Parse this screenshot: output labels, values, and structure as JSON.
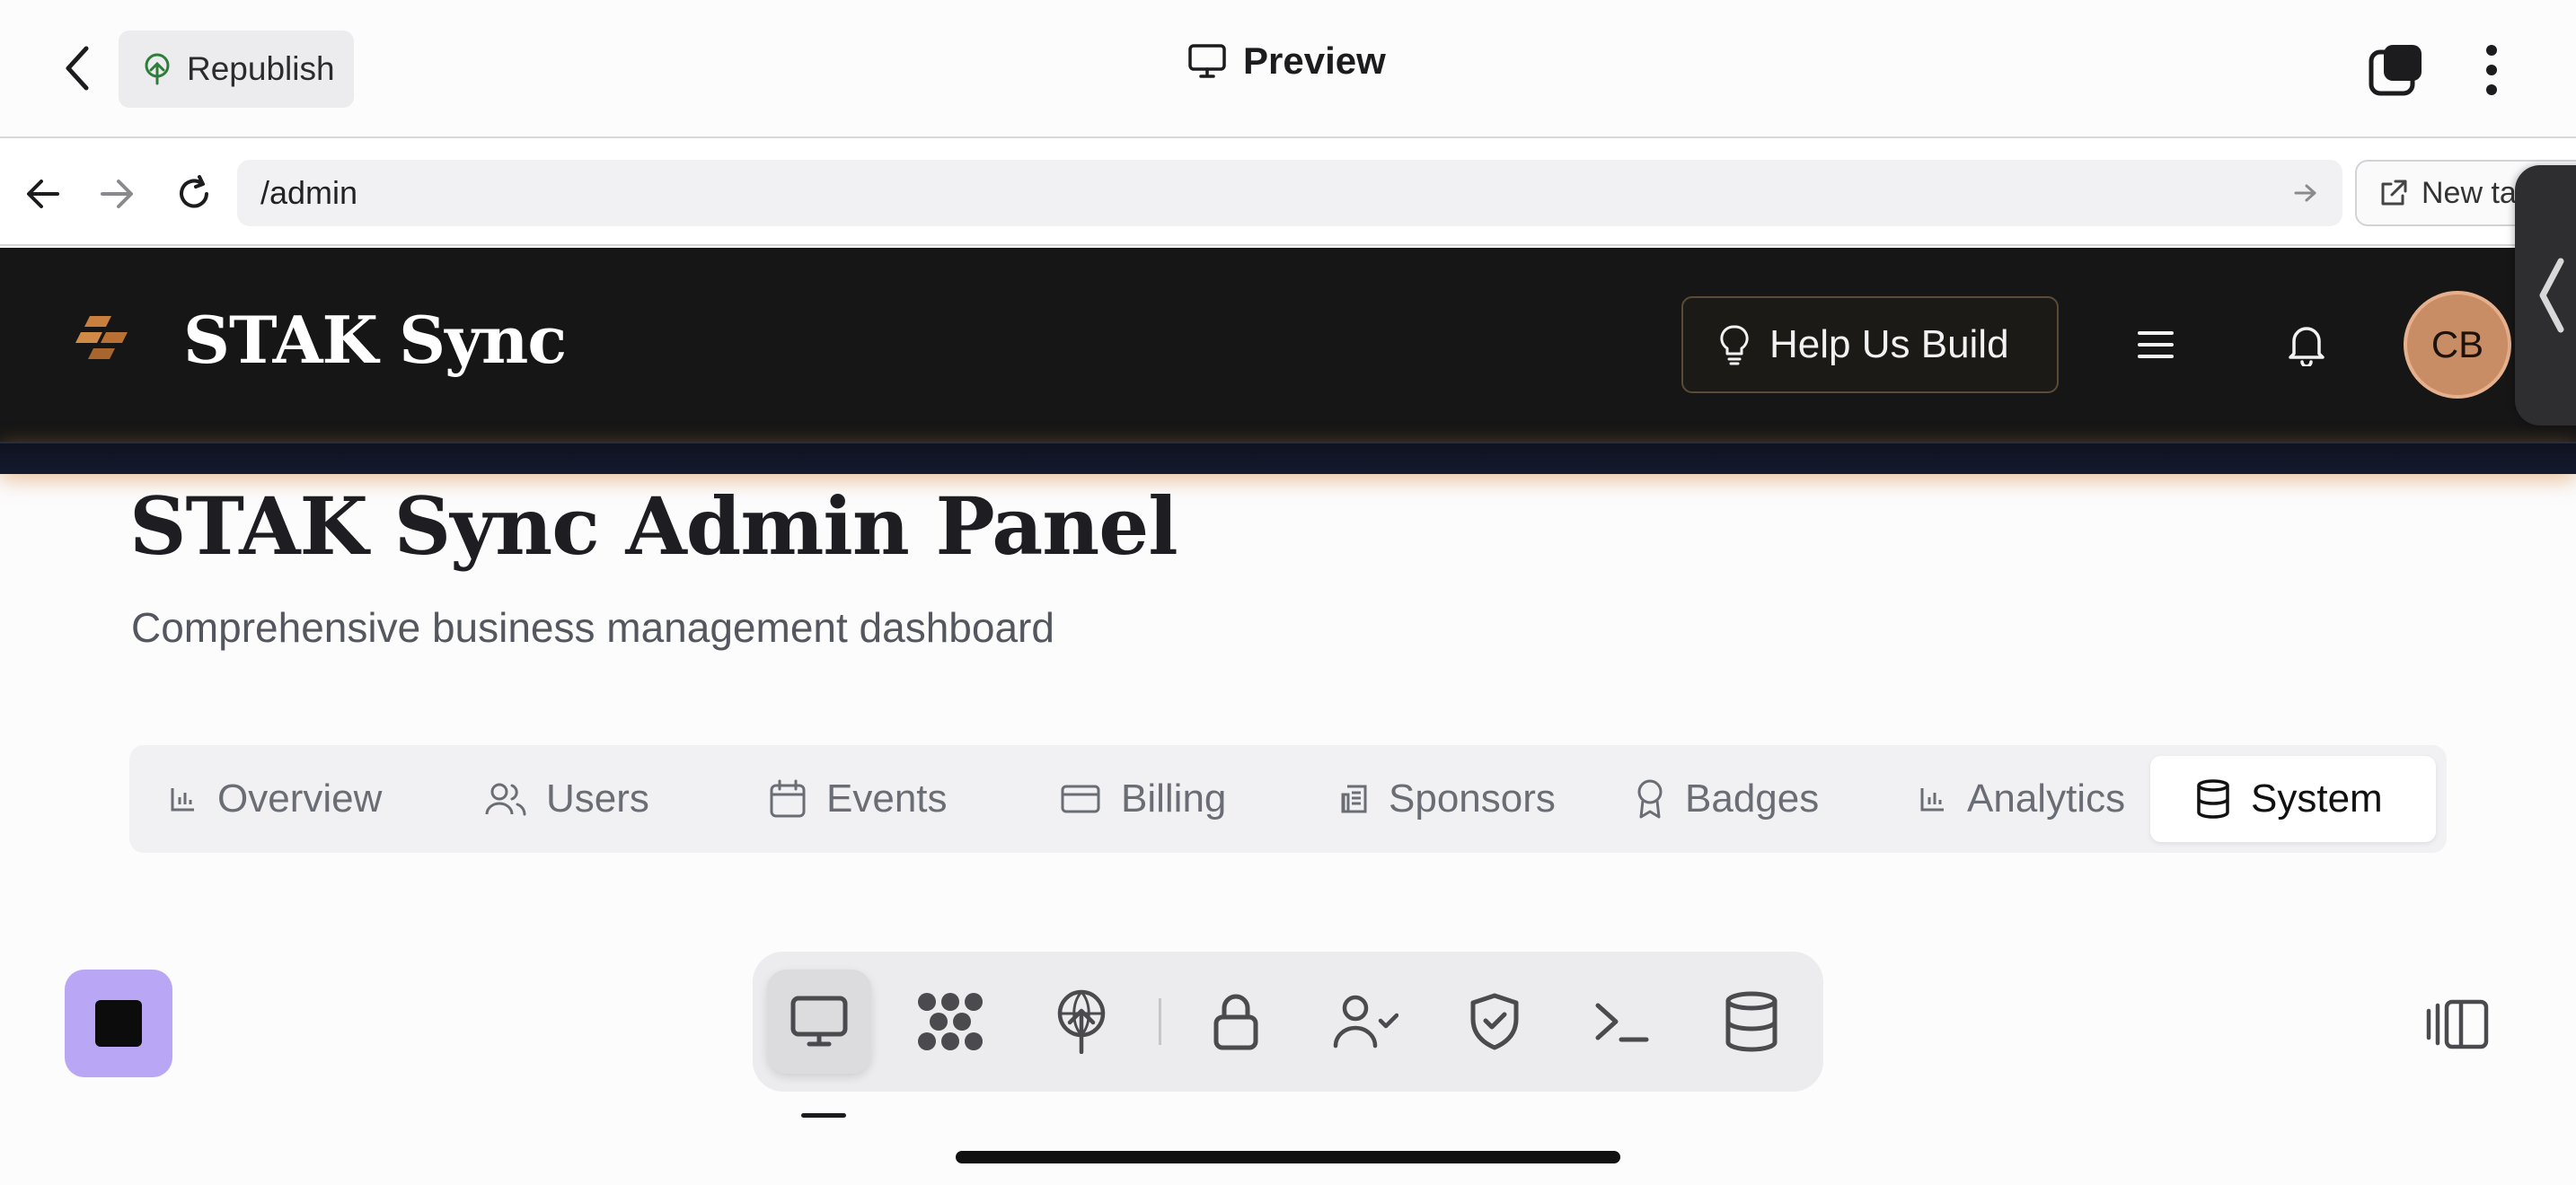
{
  "topbar": {
    "republish_label": "Republish",
    "title": "Preview"
  },
  "browser": {
    "url": "/admin",
    "new_tab_label": "New tab"
  },
  "site": {
    "brand": "STAK Sync",
    "help_label": "Help Us Build",
    "avatar_initials": "CB",
    "accent_color": "#c98d66"
  },
  "page": {
    "title": "STAK Sync Admin Panel",
    "subtitle": "Comprehensive business management dashboard"
  },
  "admin_tabs": [
    {
      "label": "Overview",
      "icon": "bar-chart-icon"
    },
    {
      "label": "Users",
      "icon": "users-icon"
    },
    {
      "label": "Events",
      "icon": "calendar-icon"
    },
    {
      "label": "Billing",
      "icon": "credit-card-icon"
    },
    {
      "label": "Sponsors",
      "icon": "receipt-icon"
    },
    {
      "label": "Badges",
      "icon": "award-icon"
    },
    {
      "label": "Analytics",
      "icon": "bar-chart-icon"
    },
    {
      "label": "System",
      "icon": "database-icon",
      "active": true
    }
  ],
  "dock": {
    "items": [
      "preview-icon",
      "agent-icon",
      "deploy-icon",
      "lock-icon",
      "user-check-icon",
      "shield-icon",
      "terminal-icon",
      "database-icon"
    ],
    "stop_color": "#b9a6f5"
  }
}
